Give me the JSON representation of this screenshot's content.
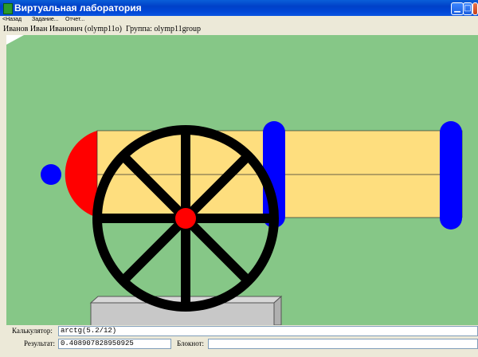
{
  "window": {
    "title": "Виртуальная лаборатория"
  },
  "menu": {
    "back": "<Назад",
    "task": "Задание...",
    "report": "Отчет..."
  },
  "user": {
    "name": "Иванов Иван Иванович (olymp11o)",
    "group": "Группа: olymp11group"
  },
  "bottom": {
    "calculator_label": "Калькулятор:",
    "calculator_value": "arctg(5.2/12)",
    "result_label": "Результат:",
    "result_value": "0.408907828950925",
    "notepad_label": "Блокнот:",
    "notepad_value": ""
  },
  "colors": {
    "ground": "#86c787",
    "barrel": "#fede7e",
    "breech": "#ff0000",
    "rings": "#0000ff",
    "wheel": "#000000",
    "hub": "#ff0000",
    "carriage": "#c8c8c8"
  }
}
